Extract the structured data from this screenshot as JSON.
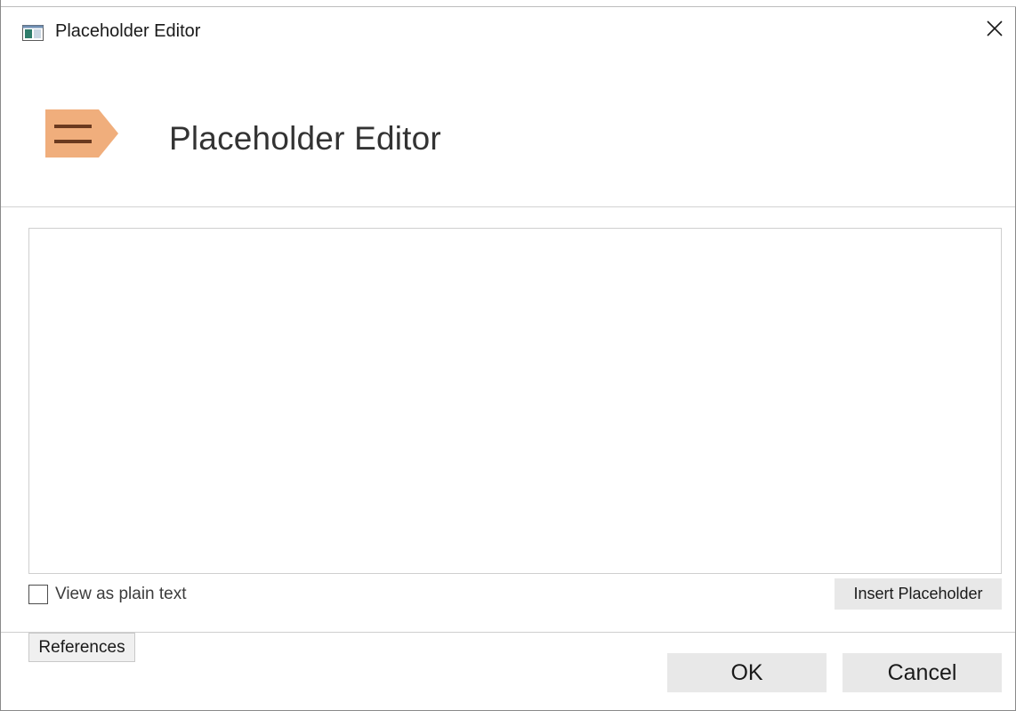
{
  "window": {
    "title": "Placeholder Editor",
    "app_icon": "window-app-icon",
    "close_icon": "close-icon"
  },
  "header": {
    "title": "Placeholder Editor",
    "logo_icon": "placeholder-tag-icon",
    "logo_color": "#f0ae7c",
    "logo_stroke_color": "#6b3a1f"
  },
  "editor": {
    "value": "",
    "placeholder": ""
  },
  "options": {
    "plain_text_label": "View as plain text",
    "plain_text_checked": false
  },
  "buttons": {
    "insert_placeholder": "Insert Placeholder",
    "references": "References",
    "ok": "OK",
    "cancel": "Cancel"
  }
}
